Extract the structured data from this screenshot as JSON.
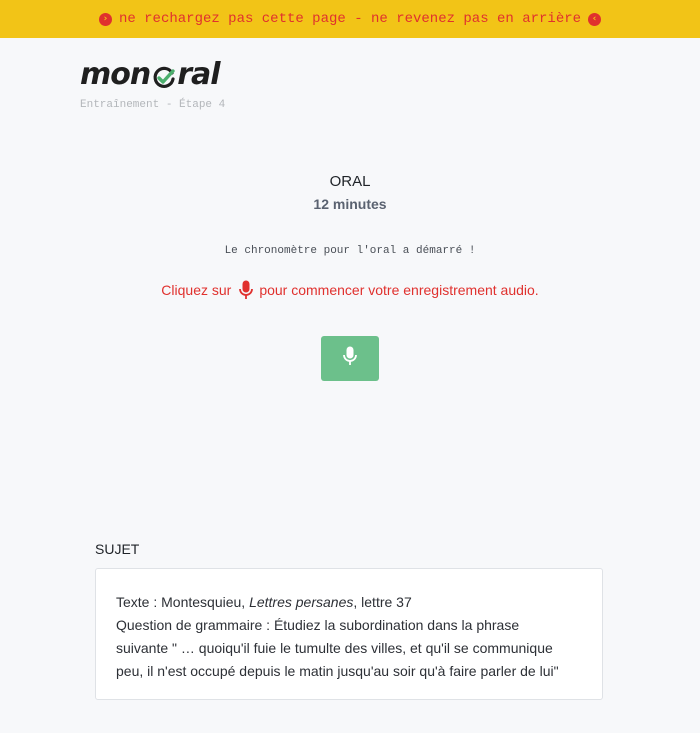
{
  "banner": {
    "text": "ne rechargez pas cette page - ne revenez pas en arrière",
    "left_icon": "chevron-right-circle-icon",
    "right_icon": "chevron-left-circle-icon",
    "color": "#e0312e",
    "background": "#f2c417"
  },
  "logo": {
    "part1": "mon",
    "part2": "ral",
    "check_color": "#4caf6e"
  },
  "subtitle": "Entraînement - Étape 4",
  "oral": {
    "title": "ORAL",
    "duration": "12 minutes"
  },
  "chrono_message": "Le chronomètre pour l'oral a démarré !",
  "instruction": {
    "before": "Cliquez sur",
    "icon": "microphone-icon",
    "after": "pour commencer votre enregistrement audio.",
    "color": "#e0312e"
  },
  "record_button": {
    "icon": "microphone-icon",
    "color": "#6cc08b"
  },
  "sujet": {
    "label": "SUJET",
    "text_prefix": "Texte : Montesquieu, ",
    "text_title": "Lettres persanes",
    "text_suffix": ", lettre 37",
    "question_line1": "Question de grammaire : Étudiez la subordination dans la phrase",
    "question_line2": "suivante \" … quoiqu'il fuie le tumulte des villes, et qu'il se communique",
    "question_line3": "peu, il n'est occupé depuis le matin jusqu'au soir qu'à faire parler de lui\""
  }
}
